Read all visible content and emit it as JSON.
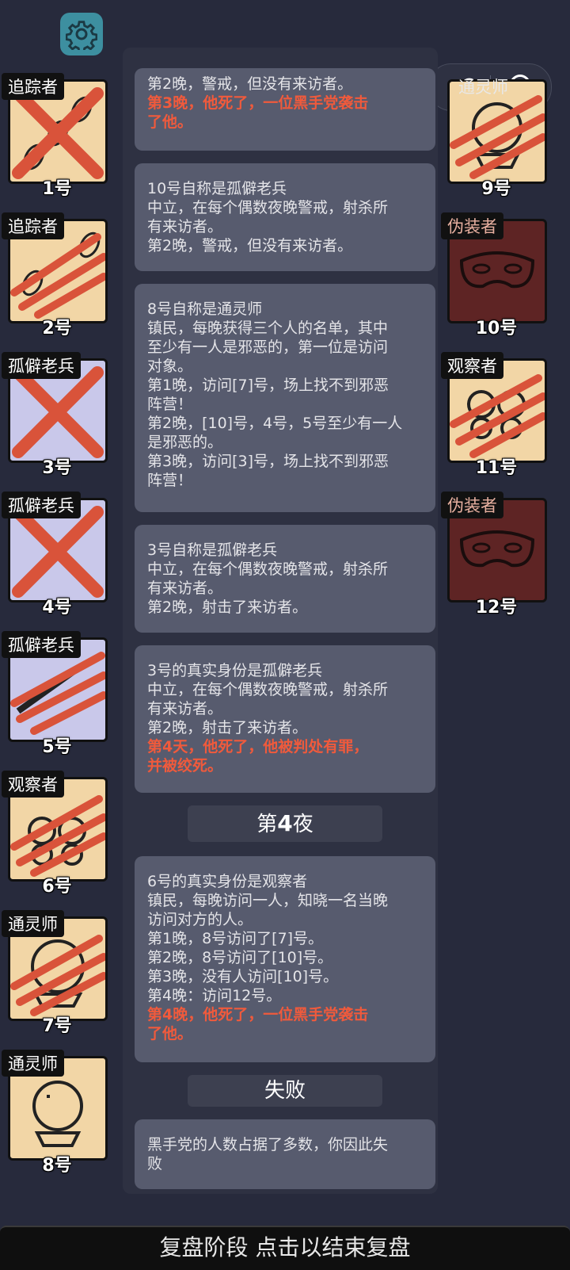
{
  "players_left": [
    {
      "role": "追踪者",
      "number": "1号",
      "status": "eliminated"
    },
    {
      "role": "追踪者",
      "number": "2号",
      "status": "killed"
    },
    {
      "role": "孤僻老兵",
      "number": "3号",
      "status": "eliminated"
    },
    {
      "role": "孤僻老兵",
      "number": "4号",
      "status": "eliminated"
    },
    {
      "role": "孤僻老兵",
      "number": "5号",
      "status": "killed"
    },
    {
      "role": "观察者",
      "number": "6号",
      "status": "killed"
    },
    {
      "role": "通灵师",
      "number": "7号",
      "status": "killed"
    },
    {
      "role": "通灵师",
      "number": "8号",
      "status": "alive"
    }
  ],
  "players_right": [
    {
      "role": "通灵师",
      "number": "9号",
      "status": "killed"
    },
    {
      "role": "伪装者",
      "number": "10号",
      "status": "alive"
    },
    {
      "role": "观察者",
      "number": "11号",
      "status": "killed"
    },
    {
      "role": "伪装者",
      "number": "12号",
      "status": "alive"
    }
  ],
  "log": {
    "bubble1": {
      "line1": "第2晚，警戒，但没有来访者。",
      "death1": "第3晚，他死了，一位黑手党袭击",
      "death2": "了他。"
    },
    "bubble2": {
      "l1": "10号自称是孤僻老兵",
      "l2": "中立，在每个偶数夜晚警戒，射杀所",
      "l3": "有来访者。",
      "l4": "第2晚，警戒，但没有来访者。"
    },
    "bubble3": {
      "l1": "8号自称是通灵师",
      "l2": "镇民，每晚获得三个人的名单，其中",
      "l3": "至少有一人是邪恶的，第一位是访问",
      "l4": "对象。",
      "l5": "第1晚，访问[7]号，场上找不到邪恶",
      "l6": "阵营！",
      "l7": "第2晚，[10]号，4号，5号至少有一人",
      "l8": "是邪恶的。",
      "l9": "第3晚，访问[3]号，场上找不到邪恶",
      "l10": "阵营！"
    },
    "bubble4": {
      "l1": "3号自称是孤僻老兵",
      "l2": "中立，在每个偶数夜晚警戒，射杀所",
      "l3": "有来访者。",
      "l4": "第2晚，射击了来访者。"
    },
    "bubble5": {
      "l1": "3号的真实身份是孤僻老兵",
      "l2": "中立，在每个偶数夜晚警戒，射杀所",
      "l3": "有来访者。",
      "l4": "第2晚，射击了来访者。",
      "death1": "第4天，他死了，他被判处有罪，",
      "death2": "并被绞死。"
    },
    "night_header": {
      "prefix": "第",
      "number": "4",
      "suffix": "夜"
    },
    "bubble6": {
      "l1": "6号的真实身份是观察者",
      "l2": "镇民，每晚访问一人，知晓一名当晚",
      "l3": "访问对方的人。",
      "l4": "第1晚，8号访问了[7]号。",
      "l5": "第2晚，8号访问了[10]号。",
      "l6": "第3晚，没有人访问[10]号。",
      "l7": "第4晚：访问12号。",
      "death1": "第4晚，他死了，一位黑手党袭击",
      "death2": "了他。"
    },
    "result_header": "失败",
    "bubble7": {
      "l1": "黑手党的人数占据了多数，你因此失",
      "l2": "败"
    }
  },
  "bottom_bar": "复盘阶段 点击以结束复盘",
  "colors": {
    "background": "#272a3c",
    "death_text": "#f05a3c",
    "card_tan": "#f2d6a6",
    "card_lavender": "#c9c8ea",
    "card_dark": "#5e2424",
    "slash": "#d9533a"
  }
}
